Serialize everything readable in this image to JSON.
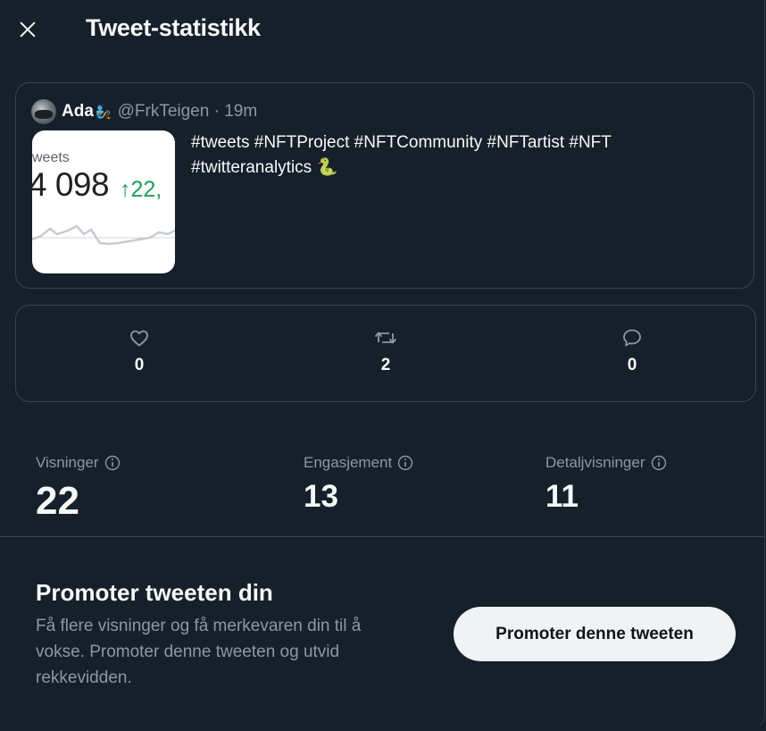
{
  "header": {
    "title": "Tweet-statistikk",
    "close_icon": "close-icon"
  },
  "tweet": {
    "author_name": "Ada",
    "author_emoji": "🧞",
    "handle_time": "@FrkTeigen · 19m",
    "text_line1": "#tweets #NFTProject #NFTCommunity #NFTartist #NFT",
    "text_line2": "#twitteranalytics 🐍",
    "thumbnail": {
      "label": "weets",
      "value": "4 098",
      "delta": "↑22,"
    }
  },
  "engagement": {
    "likes": {
      "icon": "heart-icon",
      "count": "0"
    },
    "retweets": {
      "icon": "retweet-icon",
      "count": "2"
    },
    "replies": {
      "icon": "reply-icon",
      "count": "0"
    }
  },
  "metrics": [
    {
      "label": "Visninger",
      "value": "22",
      "icon": "info-icon"
    },
    {
      "label": "Engasjement",
      "value": "13",
      "icon": "info-icon"
    },
    {
      "label": "Detaljvisninger",
      "value": "11",
      "icon": "info-icon"
    }
  ],
  "promote": {
    "title": "Promoter tweeten din",
    "description": "Få flere visninger og få merkevaren din til å vokse. Promoter denne tweeten og utvid rekkevidden.",
    "button_label": "Promoter denne tweeten"
  },
  "colors": {
    "background": "#15202b",
    "border": "#38444d",
    "secondary_text": "#8b98a5",
    "button_bg": "#eff3f4",
    "trend_green": "#1e9e5a"
  }
}
